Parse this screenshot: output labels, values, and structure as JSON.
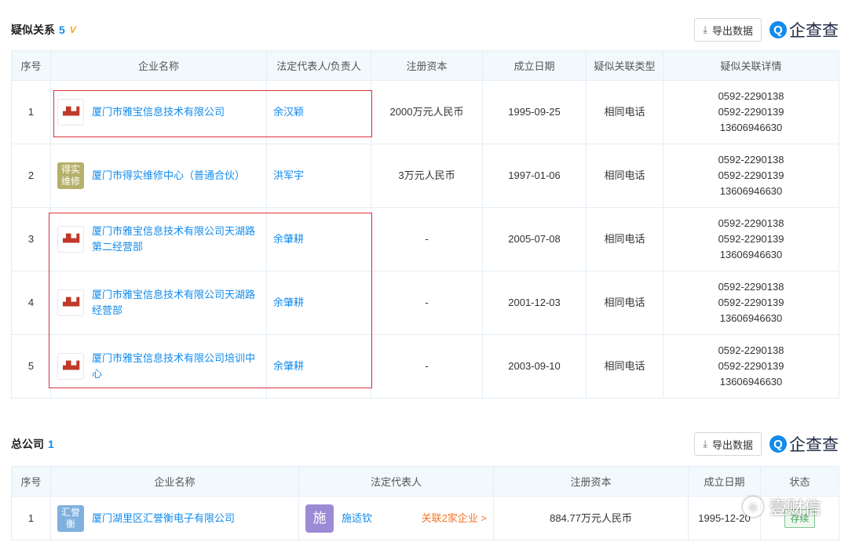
{
  "similar": {
    "title": "疑似关系",
    "count": "5",
    "vip": "V",
    "export_label": "导出数据",
    "brand": "企查查",
    "brand_q": "Q",
    "columns": [
      "序号",
      "企业名称",
      "法定代表人/负责人",
      "注册资本",
      "成立日期",
      "疑似关联类型",
      "疑似关联详情"
    ],
    "rows": [
      {
        "index": "1",
        "logo": "image",
        "name": "厦门市雅宝信息技术有限公司",
        "person": "余汉颖",
        "capital": "2000万元人民币",
        "date": "1995-09-25",
        "type": "相同电话",
        "phone1": "0592-2290138",
        "phone2": "0592-2290139",
        "phone3": "13606946630"
      },
      {
        "index": "2",
        "logo": "得实维修",
        "name": "厦门市得实维修中心（普通合伙）",
        "person": "洪军宇",
        "capital": "3万元人民币",
        "date": "1997-01-06",
        "type": "相同电话",
        "phone1": "0592-2290138",
        "phone2": "0592-2290139",
        "phone3": "13606946630"
      },
      {
        "index": "3",
        "logo": "image",
        "name": "厦门市雅宝信息技术有限公司天湖路第二经营部",
        "person": "余肇耕",
        "capital": "-",
        "date": "2005-07-08",
        "type": "相同电话",
        "phone1": "0592-2290138",
        "phone2": "0592-2290139",
        "phone3": "13606946630"
      },
      {
        "index": "4",
        "logo": "image",
        "name": "厦门市雅宝信息技术有限公司天湖路经营部",
        "person": "余肇耕",
        "capital": "-",
        "date": "2001-12-03",
        "type": "相同电话",
        "phone1": "0592-2290138",
        "phone2": "0592-2290139",
        "phone3": "13606946630"
      },
      {
        "index": "5",
        "logo": "image",
        "name": "厦门市雅宝信息技术有限公司培训中心",
        "person": "余肇耕",
        "capital": "-",
        "date": "2003-09-10",
        "type": "相同电话",
        "phone1": "0592-2290138",
        "phone2": "0592-2290139",
        "phone3": "13606946630"
      }
    ]
  },
  "headquarters": {
    "title": "总公司",
    "count": "1",
    "export_label": "导出数据",
    "brand": "企查查",
    "brand_q": "Q",
    "columns": [
      "序号",
      "企业名称",
      "法定代表人",
      "注册资本",
      "成立日期",
      "状态"
    ],
    "row": {
      "index": "1",
      "logo": "汇誉衡",
      "name": "厦门湖里区汇誉衡电子有限公司",
      "avatar": "施",
      "person": "施适钦",
      "related": "关联2家企业 >",
      "capital": "884.77万元人民币",
      "date": "1995-12-20",
      "status": "存续"
    }
  },
  "watermark": {
    "text": "壹财信"
  },
  "colors": {
    "accent": "#128bed",
    "highlight_box": "#e0323a",
    "header_bg": "#f2f9fc"
  }
}
